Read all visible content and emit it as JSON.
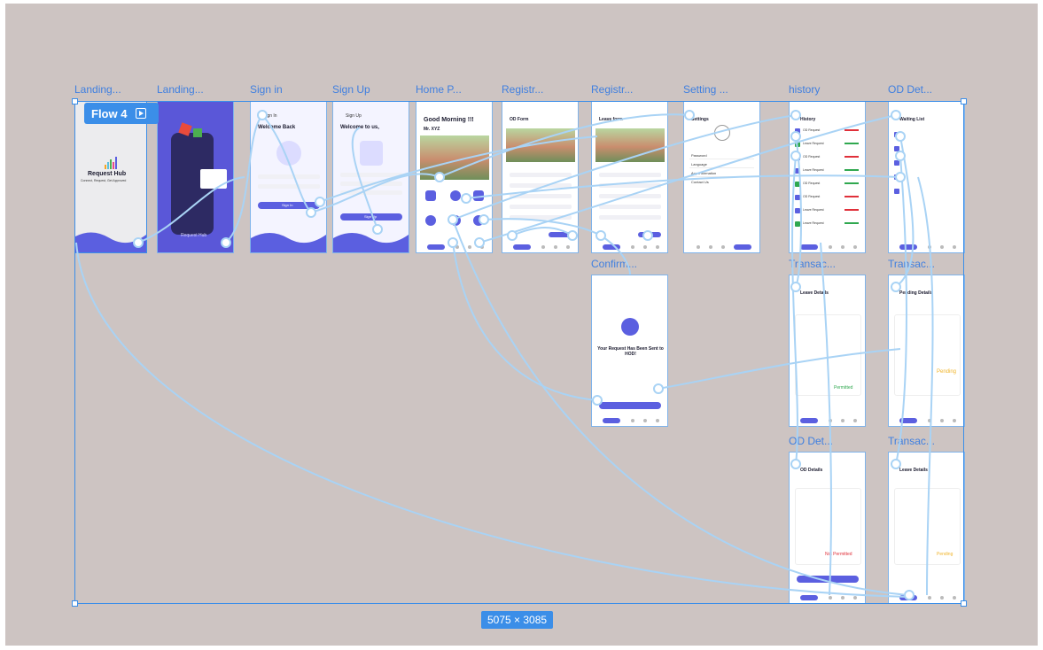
{
  "canvas": {
    "background": "#cdc4c2",
    "accent": "#3b8ee8",
    "connector_color": "#a9d3f5"
  },
  "flow": {
    "label": "Flow 4",
    "icon": "play-icon"
  },
  "selection": {
    "size_label": "5075 × 3085"
  },
  "frames": {
    "landing1": {
      "label": "Landing...",
      "logo_title": "Request Hub",
      "logo_tagline": "Connect, Request, Get Approved"
    },
    "landing2": {
      "label": "Landing...",
      "caption": "Request Hub"
    },
    "signin": {
      "label": "Sign in",
      "header": "Sign In",
      "title": "Welcome Back",
      "button": "Sign In"
    },
    "signup": {
      "label": "Sign Up",
      "header": "Sign Up",
      "title": "Welcome to us,",
      "button": "Sign Up"
    },
    "home": {
      "label": "Home P...",
      "greeting": "Good Morning !!!",
      "user": "Mr. XYZ"
    },
    "odform": {
      "label": "Registr...",
      "title": "OD Form"
    },
    "leaveform": {
      "label": "Registr...",
      "title": "Leave form"
    },
    "settings": {
      "label": "Setting ...",
      "title": "Settings",
      "items": [
        "Password",
        "Language",
        "App Information",
        "Contact Us"
      ]
    },
    "history": {
      "label": "history",
      "title": "History",
      "entries": [
        "OD Request",
        "Leave Request",
        "OD Request",
        "Leave Request",
        "OD Request",
        "OD Request",
        "Leave Request",
        "Leave Request"
      ]
    },
    "oddet": {
      "label": "OD Det...",
      "title": "Waiting List"
    },
    "confirm": {
      "label": "Confirm...",
      "message": "Your Request Has Been Sent to HOD!"
    },
    "trans1": {
      "label": "Transac...",
      "title": "Leave Details",
      "status": "Permitted"
    },
    "trans2": {
      "label": "Transac...",
      "title": "Pending Details",
      "status": "Pending"
    },
    "oddet2": {
      "label": "OD Det...",
      "title": "OD Details",
      "status": "Not Permitted"
    },
    "trans3": {
      "label": "Transac...",
      "title": "Leave Details",
      "status": "Pending"
    }
  }
}
